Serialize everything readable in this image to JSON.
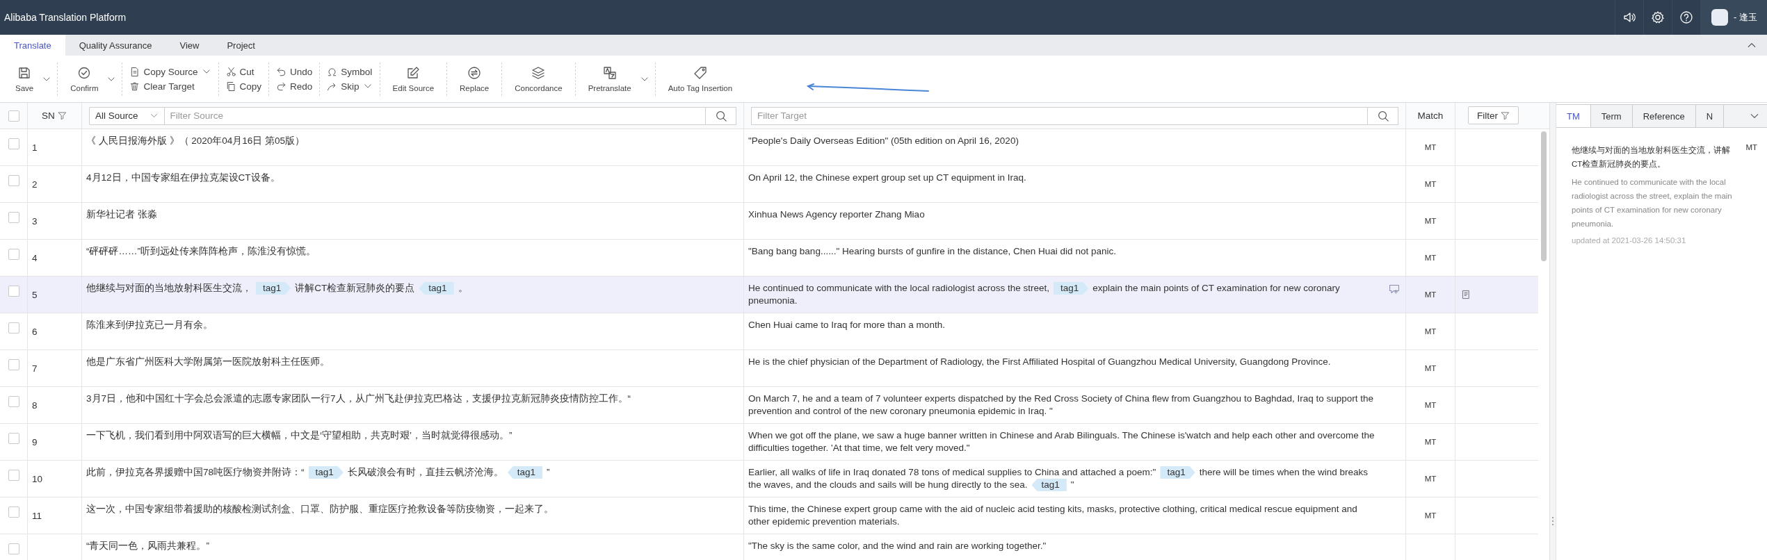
{
  "app": {
    "title": "Alibaba Translation Platform",
    "user_name": "- 逢玉"
  },
  "menu_tabs": [
    {
      "label": "Translate",
      "selected": true
    },
    {
      "label": "Quality Assurance",
      "selected": false
    },
    {
      "label": "View",
      "selected": false
    },
    {
      "label": "Project",
      "selected": false
    }
  ],
  "toolbar": [
    {
      "kind": "large",
      "items": [
        {
          "label": "Save",
          "dropdown": true
        }
      ]
    },
    {
      "kind": "large",
      "items": [
        {
          "label": "Confirm",
          "dropdown": true
        }
      ]
    },
    {
      "kind": "stacked",
      "items": [
        {
          "label": "Copy Source",
          "dropdown": true
        },
        {
          "label": "Clear Target",
          "dropdown": false
        }
      ]
    },
    {
      "kind": "stacked",
      "items": [
        {
          "label": "Cut",
          "dropdown": false
        },
        {
          "label": "Copy",
          "dropdown": false
        }
      ]
    },
    {
      "kind": "stacked",
      "items": [
        {
          "label": "Undo",
          "dropdown": false
        },
        {
          "label": "Redo",
          "dropdown": false
        }
      ]
    },
    {
      "kind": "stacked",
      "items": [
        {
          "label": "Symbol",
          "dropdown": false
        },
        {
          "label": "Skip",
          "dropdown": true
        }
      ]
    },
    {
      "kind": "large",
      "items": [
        {
          "label": "Edit Source",
          "dropdown": false
        }
      ]
    },
    {
      "kind": "large",
      "items": [
        {
          "label": "Replace",
          "dropdown": false
        }
      ]
    },
    {
      "kind": "large",
      "items": [
        {
          "label": "Concordance",
          "dropdown": false
        }
      ]
    },
    {
      "kind": "large",
      "items": [
        {
          "label": "Pretranslate",
          "dropdown": true
        }
      ]
    },
    {
      "kind": "large",
      "items": [
        {
          "label": "Auto Tag Insertion",
          "dropdown": false
        }
      ]
    }
  ],
  "grid": {
    "select_all_checked": false,
    "sn_label": "SN",
    "source_scope": "All Source",
    "source_placeholder": "Filter Source",
    "target_placeholder": "Filter Target",
    "match_label": "Match",
    "filter_button": "Filter",
    "rows": [
      {
        "sn": "1",
        "checked": false,
        "selected": false,
        "source": [
          {
            "kind": "text",
            "text": "《 人民日报海外版 》（ 2020年04月16日 第05版）"
          }
        ],
        "target": [
          {
            "kind": "text",
            "text": "\"People's Daily Overseas Edition\" (05th edition on April 16, 2020)"
          }
        ],
        "match": "MT",
        "comment_icon": false,
        "note_icon": false
      },
      {
        "sn": "2",
        "checked": false,
        "selected": false,
        "source": [
          {
            "kind": "text",
            "text": "4月12日，中国专家组在伊拉克架设CT设备。"
          }
        ],
        "target": [
          {
            "kind": "text",
            "text": "On April 12, the Chinese expert group set up CT equipment in Iraq."
          }
        ],
        "match": "MT",
        "comment_icon": false,
        "note_icon": false
      },
      {
        "sn": "3",
        "checked": false,
        "selected": false,
        "source": [
          {
            "kind": "text",
            "text": "新华社记者 张淼"
          }
        ],
        "target": [
          {
            "kind": "text",
            "text": "Xinhua News Agency reporter Zhang Miao"
          }
        ],
        "match": "MT",
        "comment_icon": false,
        "note_icon": false
      },
      {
        "sn": "4",
        "checked": false,
        "selected": false,
        "source": [
          {
            "kind": "text",
            "text": "“砰砰砰……”听到远处传来阵阵枪声，陈淮没有惊慌。"
          }
        ],
        "target": [
          {
            "kind": "text",
            "text": "\"Bang bang bang......\" Hearing bursts of gunfire in the distance, Chen Huai did not panic."
          }
        ],
        "match": "MT",
        "comment_icon": false,
        "note_icon": false
      },
      {
        "sn": "5",
        "checked": false,
        "selected": true,
        "source": [
          {
            "kind": "text",
            "text": "他继续与对面的当地放射科医生交流，"
          },
          {
            "kind": "tag_open",
            "text": "tag1"
          },
          {
            "kind": "text",
            "text": "讲解CT检查新冠肺炎的要点"
          },
          {
            "kind": "tag_close",
            "text": "tag1"
          },
          {
            "kind": "text",
            "text": "。"
          }
        ],
        "target": [
          {
            "kind": "text",
            "text": "He continued to communicate with the local radiologist across the street,"
          },
          {
            "kind": "tag_open",
            "text": "tag1"
          },
          {
            "kind": "text",
            "text": "explain the main points of CT examination for new coronary pneumonia."
          }
        ],
        "match": "MT",
        "comment_icon": true,
        "note_icon": true
      },
      {
        "sn": "6",
        "checked": false,
        "selected": false,
        "source": [
          {
            "kind": "text",
            "text": "陈淮来到伊拉克已一月有余。"
          }
        ],
        "target": [
          {
            "kind": "text",
            "text": "Chen Huai came to Iraq for more than a month."
          }
        ],
        "match": "MT",
        "comment_icon": false,
        "note_icon": false
      },
      {
        "sn": "7",
        "checked": false,
        "selected": false,
        "source": [
          {
            "kind": "text",
            "text": "他是广东省广州医科大学附属第一医院放射科主任医师。"
          }
        ],
        "target": [
          {
            "kind": "text",
            "text": "He is the chief physician of the Department of Radiology, the First Affiliated Hospital of Guangzhou Medical University, Guangdong Province."
          }
        ],
        "match": "MT",
        "comment_icon": false,
        "note_icon": false
      },
      {
        "sn": "8",
        "checked": false,
        "selected": false,
        "source": [
          {
            "kind": "text",
            "text": "3月7日，他和中国红十字会总会派遣的志愿专家团队一行7人，从广州飞赴伊拉克巴格达，支援伊拉克新冠肺炎疫情防控工作。“"
          }
        ],
        "target": [
          {
            "kind": "text",
            "text": "On March 7, he and a team of 7 volunteer experts dispatched by the Red Cross Society of China flew from Guangzhou to Baghdad, Iraq to support the prevention and control of the new coronary pneumonia epidemic in Iraq. \""
          }
        ],
        "match": "MT",
        "comment_icon": false,
        "note_icon": false
      },
      {
        "sn": "9",
        "checked": false,
        "selected": false,
        "source": [
          {
            "kind": "text",
            "text": "一下飞机，我们看到用中阿双语写的巨大横幅，中文是‘守望相助，共克时艰’，当时就觉得很感动。”"
          }
        ],
        "target": [
          {
            "kind": "text",
            "text": "When we got off the plane, we saw a huge banner written in Chinese and Arab Bilinguals. The Chinese is'watch and help each other and overcome the difficulties together. 'At that time, we felt very moved.\""
          }
        ],
        "match": "MT",
        "comment_icon": false,
        "note_icon": false
      },
      {
        "sn": "10",
        "checked": false,
        "selected": false,
        "source": [
          {
            "kind": "text",
            "text": "此前，伊拉克各界援赠中国78吨医疗物资并附诗：“"
          },
          {
            "kind": "tag_open",
            "text": "tag1"
          },
          {
            "kind": "text",
            "text": "长风破浪会有时，直挂云帆济沧海。"
          },
          {
            "kind": "tag_close",
            "text": "tag1"
          },
          {
            "kind": "text",
            "text": "”"
          }
        ],
        "target": [
          {
            "kind": "text",
            "text": "Earlier, all walks of life in Iraq donated 78 tons of medical supplies to China and attached a poem:\""
          },
          {
            "kind": "tag_open",
            "text": "tag1"
          },
          {
            "kind": "text",
            "text": "there will be times when the wind breaks the waves, and the clouds and sails will be hung directly to the sea."
          },
          {
            "kind": "tag_close",
            "text": "tag1"
          },
          {
            "kind": "text",
            "text": "\""
          }
        ],
        "match": "MT",
        "comment_icon": false,
        "note_icon": false
      },
      {
        "sn": "11",
        "checked": false,
        "selected": false,
        "source": [
          {
            "kind": "text",
            "text": "这一次，中国专家组带着援助的核酸检测试剂盒、口罩、防护服、重症医疗抢救设备等防疫物资，一起来了。"
          }
        ],
        "target": [
          {
            "kind": "text",
            "text": "This time, the Chinese expert group came with the aid of nucleic acid testing kits, masks, protective clothing, critical medical rescue equipment and other epidemic prevention materials."
          }
        ],
        "match": "MT",
        "comment_icon": false,
        "note_icon": false
      },
      {
        "checked": false,
        "selected": false,
        "source": [
          {
            "kind": "text",
            "text": "“青天同一色，风雨共兼程。”"
          }
        ],
        "target": [
          {
            "kind": "text",
            "text": "\"The sky is the same color, and the wind and rain are working together.\""
          }
        ],
        "comment_icon": false,
        "note_icon": false
      }
    ]
  },
  "side": {
    "tabs": [
      {
        "label": "TM",
        "selected": true
      },
      {
        "label": "Term",
        "selected": false
      },
      {
        "label": "Reference",
        "selected": false
      },
      {
        "label": "N",
        "selected": false
      }
    ],
    "result": {
      "source": "他继续与对面的当地放射科医生交流，讲解CT检查新冠肺炎的要点。",
      "match": "MT",
      "target": "He continued to communicate with the local radiologist across the street, explain the main points of CT examination for new coronary pneumonia.",
      "updated": "updated at 2021-03-26 14:50:31"
    }
  }
}
